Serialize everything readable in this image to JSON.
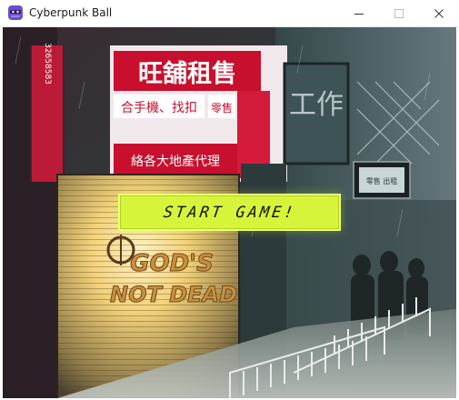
{
  "window": {
    "title": "Cyberpunk Ball",
    "icon": "app-ninja-icon"
  },
  "controls": {
    "minimize": "minimize-icon",
    "maximize": "maximize-icon",
    "close": "close-icon"
  },
  "game": {
    "start_button_label": "START GAME!",
    "sign_top": "旺舖租售",
    "sign_mid": "合手機、找扣",
    "sign_mid2": "零售",
    "sign_low": "絡各大地產代理",
    "side_sign_left": "32658583",
    "side_sign_right": "工作",
    "small_sign": "零售 出租",
    "graffiti_line1": "GOD'S",
    "graffiti_line2": "NOT DEAD"
  },
  "colors": {
    "accent": "#d6f53a",
    "sign_red": "#c8102e",
    "shutter_glow": "#f3d27a"
  }
}
